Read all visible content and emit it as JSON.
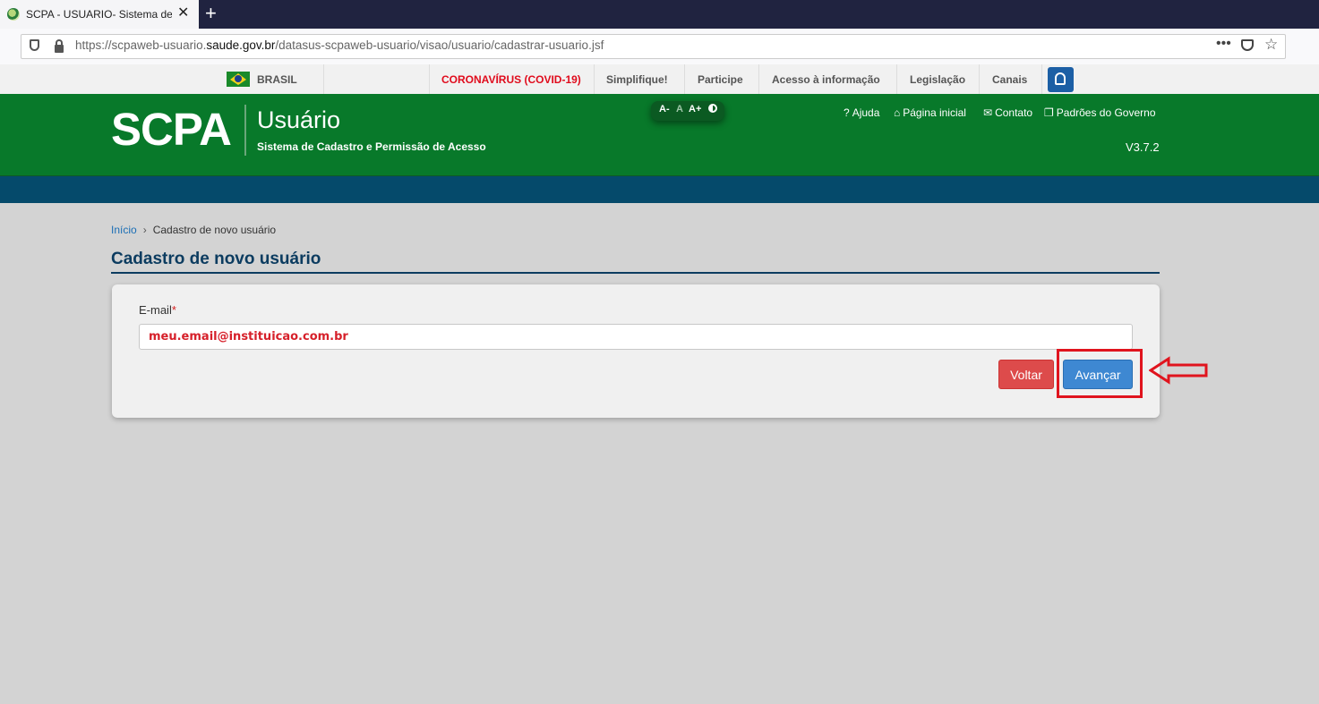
{
  "browser": {
    "tab_title": "SCPA - USUARIO- Sistema de C",
    "tab_close": "✕",
    "new_tab": "+",
    "url_prefix": "https://scpaweb-usuario.",
    "url_domain": "saude.gov.br",
    "url_path": "/datasus-scpaweb-usuario/visao/usuario/cadastrar-usuario.jsf",
    "menu_dots": "•••",
    "star": "☆"
  },
  "govbar": {
    "brasil": "BRASIL",
    "items": [
      "CORONAVÍRUS (COVID-19)",
      "Simplifique!",
      "Participe",
      "Acesso à informação",
      "Legislação",
      "Canais"
    ],
    "highlight_color": "#e00b1c"
  },
  "header": {
    "logo": "SCPA",
    "app_name": "Usuário",
    "app_subtitle": "Sistema de Cadastro e Permissão de Acesso",
    "font_controls": {
      "decrease": "A-",
      "normal": "A",
      "increase": "A+"
    },
    "links": {
      "help": "Ajuda",
      "home": "Página inicial",
      "contact": "Contato",
      "standards": "Padrões do Governo"
    },
    "version": "V3.7.2",
    "background_color": "#08792a",
    "strip_color": "#054a6b"
  },
  "breadcrumb": {
    "home": "Início",
    "separator": "›",
    "current": "Cadastro de novo usuário"
  },
  "page": {
    "title": "Cadastro de novo usuário"
  },
  "form": {
    "email_label": "E-mail",
    "required_mark": "*",
    "email_value": "meu.email@instituicao.com.br",
    "back_button": "Voltar",
    "next_button": "Avançar"
  }
}
